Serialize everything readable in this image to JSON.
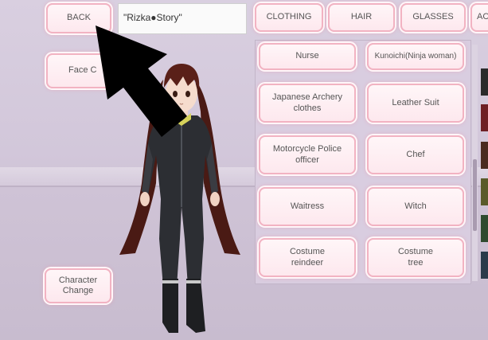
{
  "topbar": {
    "back_label": "BACK",
    "name_value": "\"Rizka●Story\""
  },
  "tabs": [
    {
      "label": "CLOTHING"
    },
    {
      "label": "HAIR"
    },
    {
      "label": "GLASSES"
    },
    {
      "label": "AC"
    }
  ],
  "left_buttons": {
    "face_label": "Face C",
    "character_change_label": "Character\nChange"
  },
  "outfits": [
    {
      "label": "Nurse"
    },
    {
      "label": "Kunoichi(Ninja woman)"
    },
    {
      "label": "Japanese Archery clothes"
    },
    {
      "label": "Leather Suit"
    },
    {
      "label": "Motorcycle Police officer"
    },
    {
      "label": "Chef"
    },
    {
      "label": "Waitress"
    },
    {
      "label": "Witch"
    },
    {
      "label": "Costume reindeer"
    },
    {
      "label": "Costume tree"
    }
  ],
  "color_swatches": [
    "#2b2b2b",
    "#6e1f24",
    "#4a2a1f",
    "#5a5a2a",
    "#2f4a2f",
    "#2a3a4a"
  ],
  "colors": {
    "button_border": "#f2b3c2",
    "button_fill": "#fde8ee",
    "background": "#d2c7da"
  }
}
